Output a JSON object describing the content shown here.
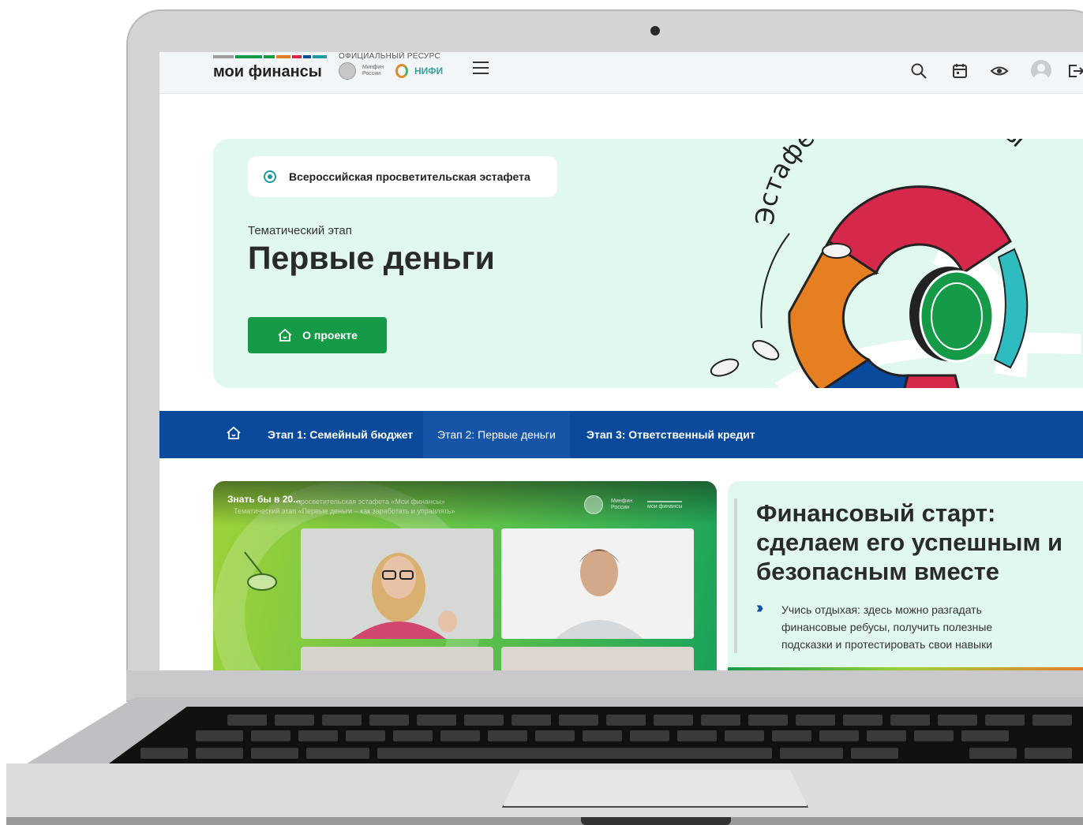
{
  "header": {
    "logo_text": "мои финансы",
    "official_label": "ОФИЦИАЛЬНЫЙ РЕСУРС",
    "minfin_label": "Минфин России",
    "nifi_label": "НИФИ",
    "logo_bar_colors": [
      "#9e9e9e",
      "#159a48",
      "#159a48",
      "#e67e22",
      "#d6284b",
      "#0a4a9c",
      "#1e9aa0"
    ]
  },
  "hero": {
    "badge": "Всероссийская просветительская эстафета",
    "stage_label": "Тематический этап",
    "title": "Первые деньги",
    "button_label": "О проекте",
    "emblem_text": "Эстафета Мои финансы"
  },
  "nav": {
    "tabs": [
      {
        "label": "Этап 1: Семейный бюджет",
        "active": false
      },
      {
        "label": "Этап 2: Первые деньги",
        "active": true
      },
      {
        "label": "Этап 3: Ответственный кредит",
        "active": false
      }
    ]
  },
  "video": {
    "title": "Знать бы в 20...",
    "subtitle_line1": "просветительская эстафета «Мои финансы»",
    "subtitle_line2": "Тематический этап «Первые деньги – как заработать и управлять»",
    "logo_minfin": "Минфин России",
    "logo_mf": "мои финансы"
  },
  "promo": {
    "title": "Финансовый старт: сделаем его успешным и безопасным вместе",
    "arrow": "››",
    "text": "Учись отдыхая: здесь можно разгадать финансовые ребусы, получить полезные подсказки и протестировать свои навыки"
  },
  "colors": {
    "brand_green": "#159a48",
    "nav_blue": "#0a4a9c",
    "mint": "#e1f8ef",
    "teal": "#1e9aa0",
    "red": "#d6284b",
    "orange": "#e67e22"
  }
}
